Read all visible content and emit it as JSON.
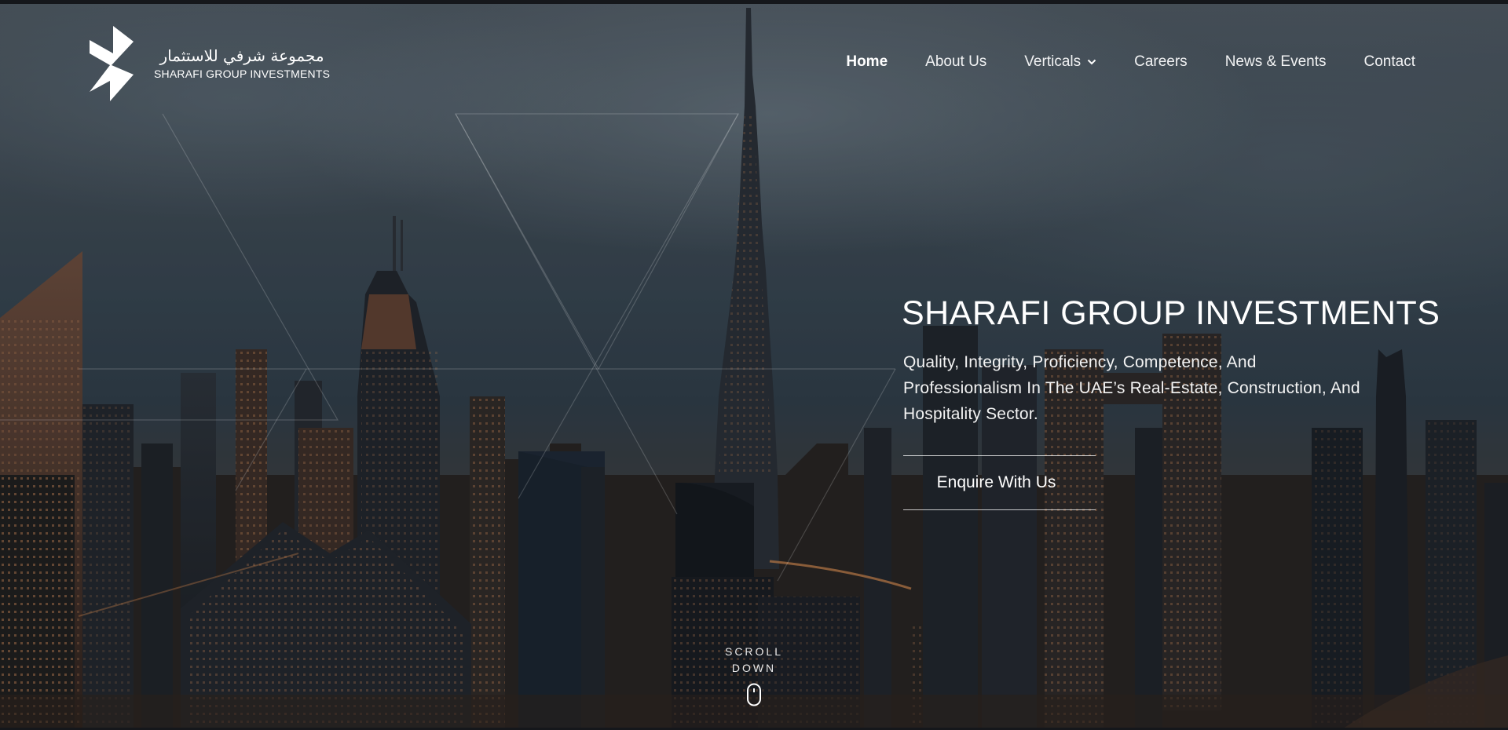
{
  "brand": {
    "name_ar": "مجموعة شرفي للاستثمار",
    "name_en": "SHARAFI GROUP INVESTMENTS",
    "logo_icon": "sharafi-logo-icon"
  },
  "nav": {
    "items": [
      {
        "label": "Home",
        "active": true
      },
      {
        "label": "About Us"
      },
      {
        "label": "Verticals",
        "has_dropdown": true
      },
      {
        "label": "Careers"
      },
      {
        "label": "News & Events"
      },
      {
        "label": "Contact"
      }
    ]
  },
  "hero": {
    "title": "SHARAFI GROUP INVESTMENTS",
    "subtitle": "Quality, Integrity, Proficiency, Competence, And Professionalism In The UAE’s Real-Estate, Construction, And Hospitality Sector.",
    "cta_label": "Enquire With Us",
    "scroll_line1": "SCROLL",
    "scroll_line2": "DOWN"
  },
  "colors": {
    "text": "#ffffff",
    "sky_top": "#4d575f",
    "sky_mid": "#2d3a44",
    "city_lights": "#d98a4a"
  }
}
